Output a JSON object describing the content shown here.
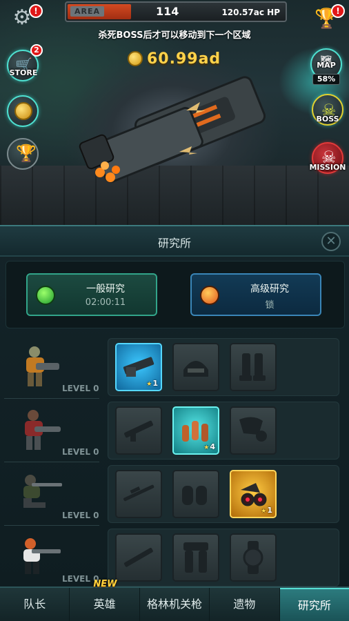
{
  "hud": {
    "area_label": "AREA",
    "area_number": "114",
    "boss_hp": "120.57ac HP",
    "boss_message": "杀死BOSS后才可以移动到下一个区域",
    "gold": "60.99ad",
    "alert_mark": "!"
  },
  "side_buttons": {
    "store_label": "STORE",
    "store_badge": "2",
    "map_label": "MAP",
    "map_progress": "58%",
    "boss_label": "BOSS",
    "mission_label": "MISSION"
  },
  "panel": {
    "title": "研究所",
    "normal_research": {
      "label": "一般研究",
      "timer": "02:00:11"
    },
    "advanced_research": {
      "label": "高级研究",
      "status": "锁"
    }
  },
  "heroes": [
    {
      "level": "LEVEL 0",
      "items": [
        {
          "icon": "minigun",
          "state": "active-blue",
          "stars": "1"
        },
        {
          "icon": "helmet",
          "state": "locked",
          "stars": ""
        },
        {
          "icon": "boots",
          "state": "locked",
          "stars": ""
        }
      ]
    },
    {
      "level": "LEVEL 0",
      "items": [
        {
          "icon": "assault-rifle",
          "state": "locked",
          "stars": ""
        },
        {
          "icon": "ammo-shells",
          "state": "active-cyan",
          "stars": "4"
        },
        {
          "icon": "armor-gauntlet",
          "state": "locked",
          "stars": ""
        }
      ]
    },
    {
      "level": "LEVEL 0",
      "items": [
        {
          "icon": "sniper-rifle",
          "state": "locked",
          "stars": ""
        },
        {
          "icon": "grenades",
          "state": "locked",
          "stars": ""
        },
        {
          "icon": "night-goggles",
          "state": "active-gold",
          "stars": "1"
        }
      ]
    },
    {
      "level": "LEVEL 0",
      "items": [
        {
          "icon": "shotgun",
          "state": "locked",
          "stars": ""
        },
        {
          "icon": "leg-armor",
          "state": "locked",
          "stars": ""
        },
        {
          "icon": "wrist-watch",
          "state": "locked",
          "stars": ""
        }
      ]
    }
  ],
  "bottom_nav": {
    "items": [
      "队长",
      "英雄",
      "格林机关枪",
      "遗物",
      "研究所"
    ],
    "new_badge": "NEW",
    "active_index": 4
  },
  "colors": {
    "accent_cyan": "#4ee0d0",
    "gold": "#ffd24a",
    "alert_red": "#e01818"
  }
}
